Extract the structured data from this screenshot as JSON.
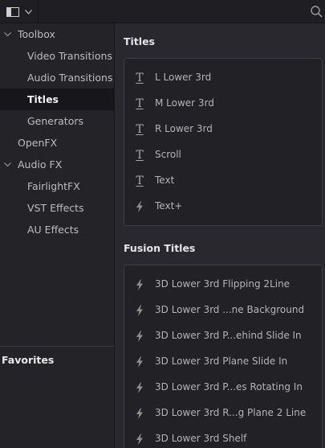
{
  "toolbar": {
    "panel_icon": "panel-toggle-icon",
    "dropdown_icon": "chevron-down-icon",
    "search_icon": "search-icon"
  },
  "sidebar": {
    "items": [
      {
        "label": "Toolbox",
        "expanded": true
      },
      {
        "label": "Video Transitions"
      },
      {
        "label": "Audio Transitions"
      },
      {
        "label": "Titles",
        "selected": true
      },
      {
        "label": "Generators"
      },
      {
        "label": "OpenFX"
      },
      {
        "label": "Audio FX",
        "expanded": true
      },
      {
        "label": "FairlightFX"
      },
      {
        "label": "VST Effects"
      },
      {
        "label": "AU Effects"
      }
    ],
    "favorites_label": "Favorites"
  },
  "titles": {
    "heading": "Titles",
    "items": [
      {
        "label": "L Lower 3rd",
        "icon": "text-title-icon"
      },
      {
        "label": "M Lower 3rd",
        "icon": "text-title-icon"
      },
      {
        "label": "R Lower 3rd",
        "icon": "text-title-icon"
      },
      {
        "label": "Scroll",
        "icon": "text-title-icon"
      },
      {
        "label": "Text",
        "icon": "text-title-icon"
      },
      {
        "label": "Text+",
        "icon": "fusion-bolt-icon"
      }
    ]
  },
  "fusion_titles": {
    "heading": "Fusion Titles",
    "items": [
      {
        "label": "3D Lower 3rd Flipping 2Line",
        "icon": "fusion-bolt-icon"
      },
      {
        "label": "3D Lower 3rd ...ne Background",
        "icon": "fusion-bolt-icon"
      },
      {
        "label": "3D Lower 3rd P...ehind Slide In",
        "icon": "fusion-bolt-icon"
      },
      {
        "label": "3D Lower 3rd Plane Slide In",
        "icon": "fusion-bolt-icon"
      },
      {
        "label": "3D Lower 3rd P...es Rotating In",
        "icon": "fusion-bolt-icon"
      },
      {
        "label": "3D Lower 3rd R...g Plane 2 Line",
        "icon": "fusion-bolt-icon"
      },
      {
        "label": "3D Lower 3rd Shelf",
        "icon": "fusion-bolt-icon"
      }
    ]
  },
  "colors": {
    "background": "#28282e",
    "sidebar": "#242428",
    "selected_row": "#17171a",
    "text": "#c9c9c9",
    "heading": "#e6e6e6"
  }
}
